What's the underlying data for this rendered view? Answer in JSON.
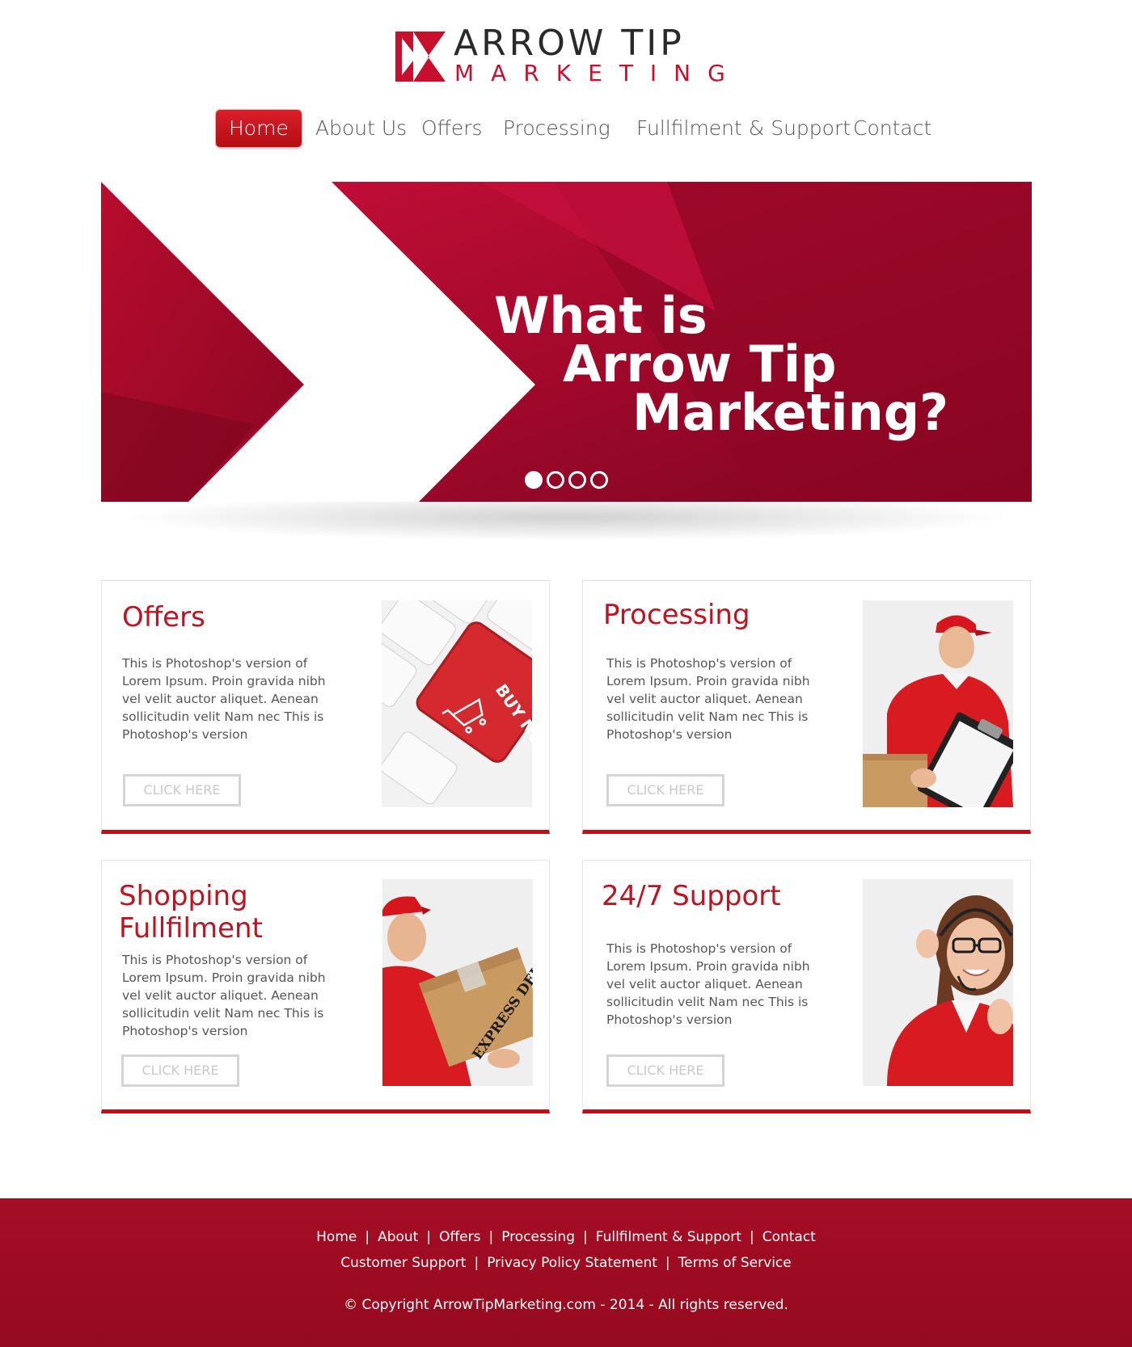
{
  "brand": {
    "title": "ARROW TIP",
    "subtitle": "MARKETING"
  },
  "nav": {
    "items": [
      {
        "label": "Home",
        "active": true
      },
      {
        "label": "About Us"
      },
      {
        "label": "Offers"
      },
      {
        "label": "Processing"
      },
      {
        "label": "Fullfilment & Support"
      },
      {
        "label": "Contact"
      }
    ]
  },
  "hero": {
    "lines": [
      "What is",
      "Arrow Tip",
      "Marketing?"
    ],
    "slide_count": 4,
    "active_slide": 1
  },
  "cards": [
    {
      "title": "Offers",
      "text": "This is Photoshop's version  of Lorem Ipsum. Proin gravida nibh vel velit auctor aliquet. Aenean sollicitudin velit Nam nec This is Photoshop's version",
      "button": "CLICK HERE",
      "image": "buy-now-keyboard-key",
      "image_text": "BUY NOW"
    },
    {
      "title": "Processing",
      "text": "This is Photoshop's version  of Lorem Ipsum. Proin gravida nibh vel velit auctor aliquet. Aenean sollicitudin velit Nam nec This is Photoshop's version",
      "button": "CLICK HERE",
      "image": "courier-with-clipboard"
    },
    {
      "title_line1": "Shopping",
      "title_line2": "Fullfilment",
      "text": "This is Photoshop's version  of Lorem Ipsum. Proin gravida nibh vel velit auctor aliquet. Aenean sollicitudin velit Nam nec This is Photoshop's version",
      "button": "CLICK HERE",
      "image": "courier-with-box",
      "image_text": "EXPRESS DELIVERY"
    },
    {
      "title": "24/7 Support",
      "text": "This is Photoshop's version  of Lorem Ipsum. Proin gravida nibh vel velit auctor aliquet. Aenean sollicitudin velit Nam nec This is Photoshop's version",
      "button": "CLICK HERE",
      "image": "support-agent-headset"
    }
  ],
  "footer": {
    "links_row1": [
      "Home",
      "About",
      "Offers",
      "Processing",
      "Fullfilment & Support",
      "Contact"
    ],
    "links_row2": [
      "Customer Support",
      "Privacy Policy Statement",
      "Terms of Service"
    ],
    "separator": "|",
    "copyright": "© Copyright ArrowTipMarketing.com - 2014 - All rights reserved."
  },
  "colors": {
    "brand_red": "#c1121f",
    "footer_red": "#a00d22",
    "hero_red": "#a5092c"
  }
}
